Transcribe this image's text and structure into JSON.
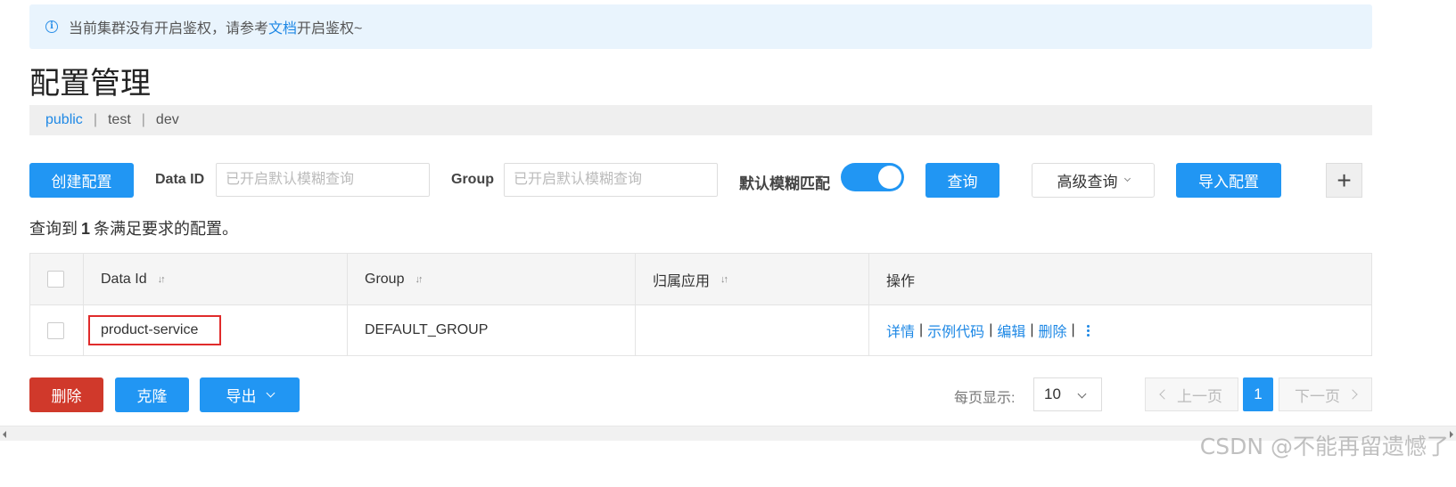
{
  "notice": {
    "text_before": "当前集群没有开启鉴权，请参考",
    "link": "文档",
    "text_after": "开启鉴权~"
  },
  "page_title": "配置管理",
  "namespaces": [
    "public",
    "test",
    "dev"
  ],
  "toolbar": {
    "create_label": "创建配置",
    "data_id_label": "Data ID",
    "data_id_placeholder": "已开启默认模糊查询",
    "group_label": "Group",
    "group_placeholder": "已开启默认模糊查询",
    "fuzzy_label": "默认模糊匹配",
    "fuzzy_on": true,
    "query_label": "查询",
    "advanced_label": "高级查询",
    "import_label": "导入配置",
    "add_label": "+"
  },
  "result": {
    "prefix": "查询到",
    "count": "1",
    "suffix": "条满足要求的配置。"
  },
  "table": {
    "headers": {
      "data_id": "Data Id",
      "group": "Group",
      "app": "归属应用",
      "ops": "操作"
    },
    "rows": [
      {
        "data_id": "product-service",
        "group": "DEFAULT_GROUP",
        "app": "",
        "ops": [
          "详情",
          "示例代码",
          "编辑",
          "删除"
        ]
      }
    ]
  },
  "footer": {
    "delete_label": "删除",
    "clone_label": "克隆",
    "export_label": "导出",
    "page_size_label": "每页显示:",
    "page_size": "10",
    "prev_label": "上一页",
    "current_page": "1",
    "next_label": "下一页"
  },
  "watermark": "CSDN @不能再留遗憾了",
  "colors": {
    "primary": "#2196f3",
    "danger": "#d0392b",
    "highlight_border": "#e02b2b",
    "notice_bg": "#e9f4fd"
  }
}
